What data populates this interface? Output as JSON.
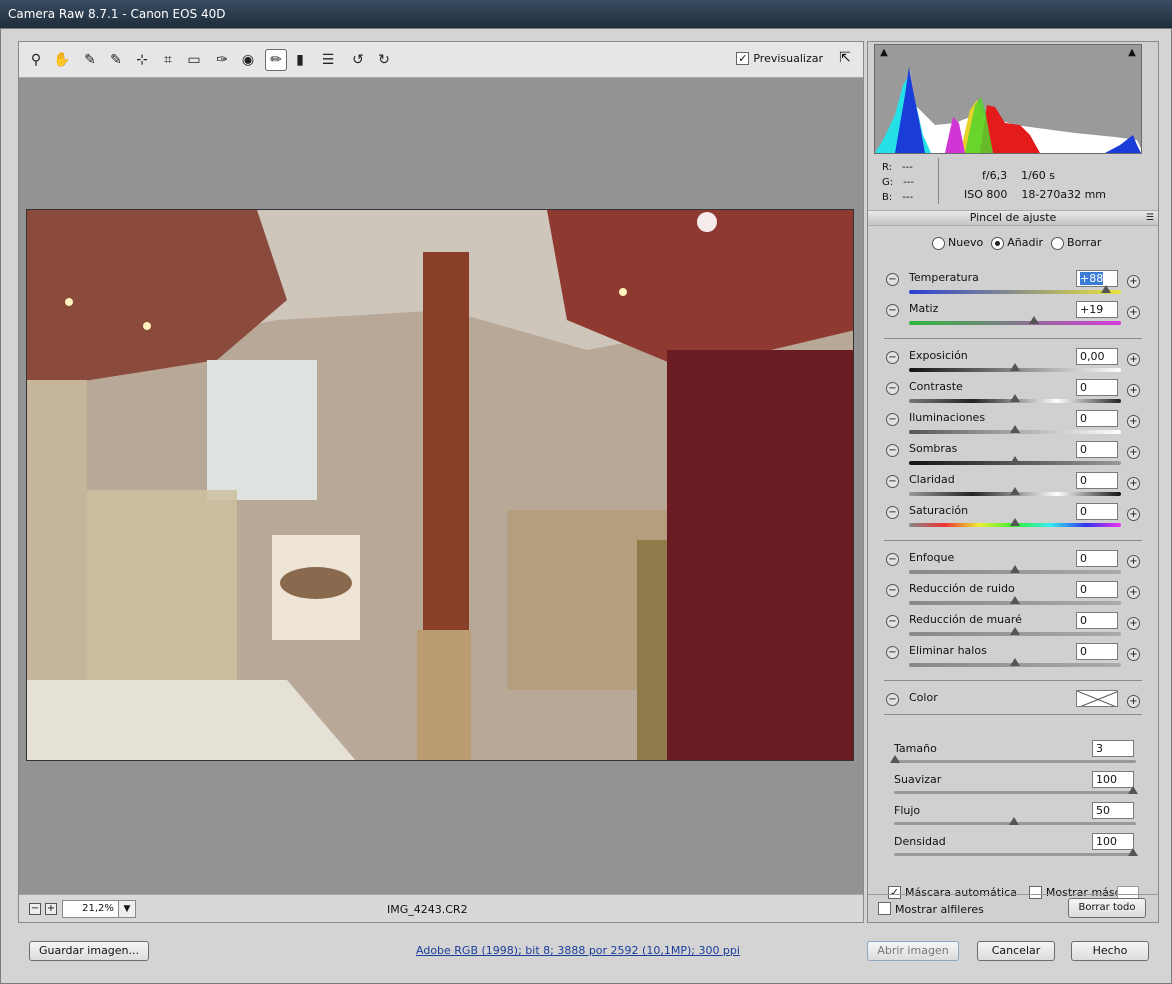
{
  "window": {
    "title": "Camera Raw 8.7.1 -  Canon EOS 40D"
  },
  "toolbar": {
    "tools": [
      {
        "name": "zoom-tool",
        "glyph": "⚲"
      },
      {
        "name": "hand-tool",
        "glyph": "✋"
      },
      {
        "name": "white-balance-tool",
        "glyph": "✎"
      },
      {
        "name": "color-sampler-tool",
        "glyph": "✎"
      },
      {
        "name": "targeted-adjustment-tool",
        "glyph": "⊹"
      },
      {
        "name": "crop-tool",
        "glyph": "⌗"
      },
      {
        "name": "straighten-tool",
        "glyph": "▭"
      },
      {
        "name": "spot-removal-tool",
        "glyph": "✑"
      },
      {
        "name": "red-eye-tool",
        "glyph": "◉"
      },
      {
        "name": "adjustment-brush-tool",
        "glyph": "✏"
      },
      {
        "name": "graduated-filter-tool",
        "glyph": "▮"
      },
      {
        "name": "preferences-tool",
        "glyph": "☰"
      },
      {
        "name": "rotate-left-tool",
        "glyph": "↺"
      },
      {
        "name": "rotate-right-tool",
        "glyph": "↻"
      }
    ],
    "preview_label": "Previsualizar",
    "preview_checked": "✓"
  },
  "status": {
    "zoom_value": "21,2%",
    "filename": "IMG_4243.CR2"
  },
  "histogram": {
    "r_label": "R:",
    "r_value": "---",
    "g_label": "G:",
    "g_value": "---",
    "b_label": "B:",
    "b_value": "---",
    "aperture": "f/6,3",
    "shutter": "1/60 s",
    "iso": "ISO 800",
    "lens": "18-270a32 mm"
  },
  "panel": {
    "title": "Pincel de ajuste",
    "modes": {
      "new": "Nuevo",
      "add": "Añadir",
      "erase": "Borrar"
    },
    "sliders": [
      {
        "key": "temperatura",
        "label": "Temperatura",
        "value": "+88",
        "pos": 0.93,
        "selected": true
      },
      {
        "key": "matiz",
        "label": "Matiz",
        "value": "+19",
        "pos": 0.59
      },
      {
        "key": "exposicion",
        "label": "Exposición",
        "value": "0,00",
        "pos": 0.5
      },
      {
        "key": "contraste",
        "label": "Contraste",
        "value": "0",
        "pos": 0.5
      },
      {
        "key": "iluminaciones",
        "label": "Iluminaciones",
        "value": "0",
        "pos": 0.5
      },
      {
        "key": "sombras",
        "label": "Sombras",
        "value": "0",
        "pos": 0.5
      },
      {
        "key": "claridad",
        "label": "Claridad",
        "value": "0",
        "pos": 0.5
      },
      {
        "key": "saturacion",
        "label": "Saturación",
        "value": "0",
        "pos": 0.5
      },
      {
        "key": "enfoque",
        "label": "Enfoque",
        "value": "0",
        "pos": 0.5
      },
      {
        "key": "reduccion-ruido",
        "label": "Reducción de ruido",
        "value": "0",
        "pos": 0.5
      },
      {
        "key": "reduccion-muare",
        "label": "Reducción de muaré",
        "value": "0",
        "pos": 0.5
      },
      {
        "key": "eliminar-halos",
        "label": "Eliminar halos",
        "value": "0",
        "pos": 0.5
      }
    ],
    "color_label": "Color",
    "brush": [
      {
        "key": "tamano",
        "label": "Tamaño",
        "value": "3",
        "pos": 0.0
      },
      {
        "key": "suavizar",
        "label": "Suavizar",
        "value": "100",
        "pos": 1.0
      },
      {
        "key": "flujo",
        "label": "Flujo",
        "value": "50",
        "pos": 0.5
      },
      {
        "key": "densidad",
        "label": "Densidad",
        "value": "100",
        "pos": 1.0
      }
    ],
    "auto_mask_label": "Máscara automática",
    "auto_mask_checked": "✓",
    "show_mask_label": "Mostrar máscara",
    "show_pins_label": "Mostrar alfileres",
    "clear_all_label": "Borrar todo"
  },
  "footer": {
    "save_label": "Guardar imagen...",
    "workflow_link": "Adobe RGB (1998); bit 8; 3888 por 2592 (10,1MP); 300 ppi",
    "open_label": "Abrir imagen",
    "cancel_label": "Cancelar",
    "done_label": "Hecho"
  }
}
